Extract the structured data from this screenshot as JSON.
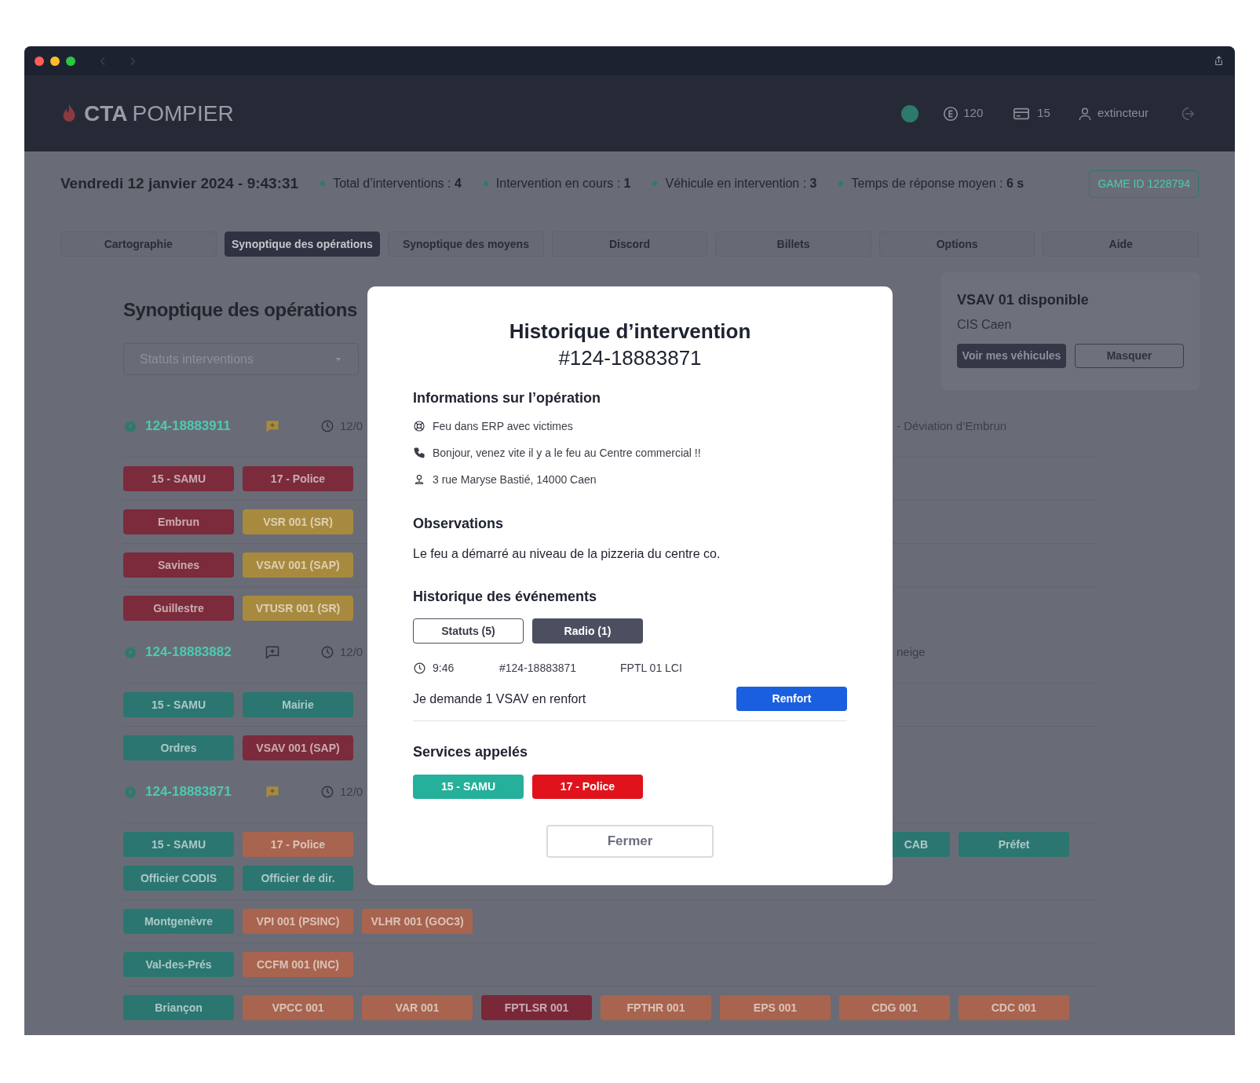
{
  "header": {
    "logo_bold": "CTA",
    "logo_light": "POMPIER",
    "online": true,
    "coins": "120",
    "cards": "15",
    "user": "extincteur"
  },
  "stats": {
    "datetime": "Vendredi 12 janvier 2024 - 9:43:31",
    "items": [
      {
        "label": "Total d’interventions :",
        "value": "4"
      },
      {
        "label": "Intervention en cours :",
        "value": "1"
      },
      {
        "label": "Véhicule en intervention :",
        "value": "3"
      },
      {
        "label": "Temps de réponse moyen :",
        "value": "6 s"
      }
    ],
    "game_id": "GAME ID 1228794"
  },
  "tabs": [
    {
      "label": "Cartographie",
      "selected": false
    },
    {
      "label": "Synoptique des opérations",
      "selected": true
    },
    {
      "label": "Synoptique des moyens",
      "selected": false
    },
    {
      "label": "Discord",
      "selected": false
    },
    {
      "label": "Billets",
      "selected": false
    },
    {
      "label": "Options",
      "selected": false
    },
    {
      "label": "Aide",
      "selected": false
    }
  ],
  "page_title": "Synoptique des opérations",
  "filter": {
    "placeholder": "Statuts interventions"
  },
  "operations": [
    {
      "id": "124-18883911",
      "new_message": true,
      "date": "12/0",
      "detail": "- Déviation d’Embrun",
      "rows": [
        {
          "lines": [
            {
              "left": [
                {
                  "label": "15 - SAMU",
                  "color": "#7b2b3b"
                },
                {
                  "label": "17 - Police",
                  "color": "#7b2b3b"
                }
              ]
            }
          ]
        },
        {
          "lines": [
            {
              "left": [
                {
                  "label": "Embrun",
                  "color": "#7b2b3b"
                },
                {
                  "label": "VSR 001 (SR)",
                  "color": "#a88a3f"
                }
              ]
            }
          ]
        },
        {
          "lines": [
            {
              "left": [
                {
                  "label": "Savines",
                  "color": "#7b2b3b"
                },
                {
                  "label": "VSAV 001 (SAP)",
                  "color": "#a88a3f"
                }
              ]
            }
          ]
        },
        {
          "lines": [
            {
              "left": [
                {
                  "label": "Guillestre",
                  "color": "#7b2b3b"
                },
                {
                  "label": "VTUSR 001 (SR)",
                  "color": "#a88a3f"
                }
              ]
            }
          ]
        }
      ]
    },
    {
      "id": "124-18883882",
      "new_message": false,
      "date": "12/0",
      "detail": "neige",
      "rows": [
        {
          "lines": [
            {
              "left": [
                {
                  "label": "15 - SAMU",
                  "color": "#2b7670"
                },
                {
                  "label": "Mairie",
                  "color": "#2b7670"
                }
              ]
            }
          ]
        },
        {
          "lines": [
            {
              "left": [
                {
                  "label": "Ordres",
                  "color": "#2b7670"
                },
                {
                  "label": "VSAV 001 (SAP)",
                  "color": "#7b2b3b"
                }
              ]
            }
          ]
        }
      ]
    },
    {
      "id": "124-18883871",
      "new_message": true,
      "date": "12/0",
      "rows": [
        {
          "lines": [
            {
              "left": [
                {
                  "label": "15 - SAMU",
                  "color": "#2b7670"
                },
                {
                  "label": "17 - Police",
                  "color": "#a8644f"
                }
              ],
              "right": [
                {
                  "label": "CAB",
                  "color": "#2b7670",
                  "cut": true
                },
                {
                  "label": "Préfet",
                  "color": "#2b7670"
                }
              ]
            },
            {
              "left": [
                {
                  "label": "Officier CODIS",
                  "color": "#2b7670"
                },
                {
                  "label": "Officier de dir.",
                  "color": "#2b7670"
                }
              ]
            }
          ]
        },
        {
          "lines": [
            {
              "left": [
                {
                  "label": "Montgenèvre",
                  "color": "#2b7670"
                },
                {
                  "label": "VPI 001 (PSINC)",
                  "color": "#a8644f"
                },
                {
                  "label": "VLHR 001 (GOC3)",
                  "color": "#a8644f"
                }
              ]
            }
          ]
        },
        {
          "lines": [
            {
              "left": [
                {
                  "label": "Val-des-Prés",
                  "color": "#2b7670"
                },
                {
                  "label": "CCFM 001 (INC)",
                  "color": "#a8644f"
                }
              ]
            }
          ]
        },
        {
          "lines": [
            {
              "left": [
                {
                  "label": "Briançon",
                  "color": "#2b7670"
                },
                {
                  "label": "VPCC 001",
                  "color": "#a8644f"
                },
                {
                  "label": "VAR 001",
                  "color": "#a8644f"
                },
                {
                  "label": "FPTLSR 001",
                  "color": "#7a2838"
                },
                {
                  "label": "FPTHR 001",
                  "color": "#a8644f"
                },
                {
                  "label": "EPS 001",
                  "color": "#a8644f"
                },
                {
                  "label": "CDG 001",
                  "color": "#a8644f"
                },
                {
                  "label": "CDC 001",
                  "color": "#a8644f"
                }
              ]
            }
          ]
        }
      ]
    }
  ],
  "notification": {
    "title": "VSAV 01 disponible",
    "subtitle": "CIS Caen",
    "primary": "Voir mes véhicules",
    "secondary": "Masquer"
  },
  "modal": {
    "title": "Historique d’intervention",
    "number": "#124-18883871",
    "info_heading": "Informations sur l’opération",
    "info": [
      {
        "kind": "incident",
        "text": "Feu dans ERP avec victimes"
      },
      {
        "kind": "call",
        "text": "Bonjour, venez vite il y a le feu au Centre commercial !!"
      },
      {
        "kind": "address",
        "text": "3 rue Maryse Bastié, 14000 Caen"
      }
    ],
    "observations_heading": "Observations",
    "observations": "Le feu a démarré au niveau de la pizzeria du centre co.",
    "history_heading": "Historique des événements",
    "history_tabs": [
      {
        "label": "Statuts (5)",
        "selected": false
      },
      {
        "label": "Radio (1)",
        "selected": true
      }
    ],
    "event": {
      "time": "9:46",
      "ref": "#124-18883871",
      "unit": "FPTL 01 LCI",
      "message": "Je demande 1 VSAV en renfort",
      "action": "Renfort"
    },
    "services_heading": "Services appelés",
    "services": [
      {
        "label": "15 - SAMU",
        "color": "#24b09a"
      },
      {
        "label": "17 - Police",
        "color": "#e0131d"
      }
    ],
    "close": "Fermer"
  }
}
